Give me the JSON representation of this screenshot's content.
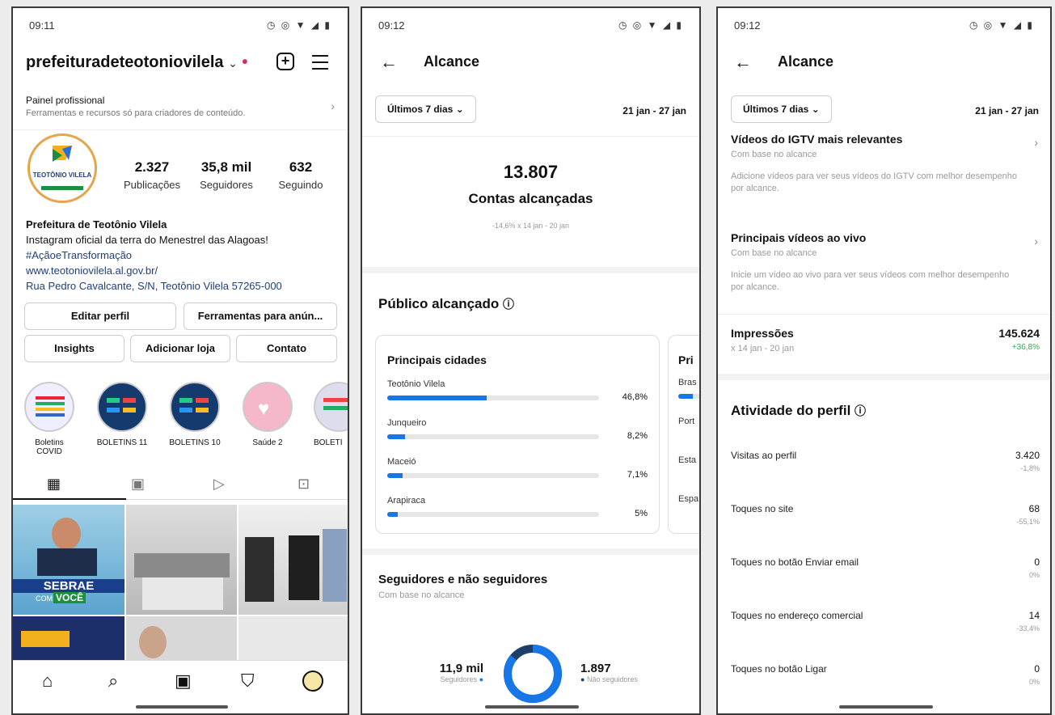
{
  "screen1": {
    "time": "09:11",
    "username": "prefeituradeteotoniovilela",
    "chevron": "⌄",
    "red_dot": "•",
    "pro_panel": {
      "title": "Painel profissional",
      "subtitle": "Ferramentas e recursos só para criadores de conteúdo."
    },
    "avatar_text": "TEOTÔNIO VILELA",
    "stats": [
      {
        "value": "2.327",
        "label": "Publicações"
      },
      {
        "value": "35,8 mil",
        "label": "Seguidores"
      },
      {
        "value": "632",
        "label": "Seguindo"
      }
    ],
    "bio": {
      "name": "Prefeitura de Teotônio Vilela",
      "line1": "Instagram oficial da terra do Menestrel das Alagoas!",
      "hashtag": "#AçãoeTransformação",
      "link": "www.teotoniovilela.al.gov.br/",
      "address": "Rua Pedro Cavalcante, S/N, Teotônio Vilela 57265-000"
    },
    "buttons": {
      "edit": "Editar perfil",
      "ads": "Ferramentas para anún...",
      "insights": "Insights",
      "shop": "Adicionar loja",
      "contact": "Contato"
    },
    "highlights": [
      "Boletins COVID",
      "BOLETINS 11",
      "BOLETINS 10",
      "Saúde 2",
      "BOLETI"
    ],
    "sebrae": {
      "l1": "SEBRAE",
      "l2": "COM",
      "l3": "VOCÊ"
    }
  },
  "screen2": {
    "time": "09:12",
    "title": "Alcance",
    "filter": "Últimos 7 dias",
    "date_range": "21 jan - 27 jan",
    "reach_value": "13.807",
    "reach_label": "Contas alcançadas",
    "reach_compare": "-14,6% x 14 jan - 20 jan",
    "audience_title": "Público alcançado",
    "cities_title": "Principais cidades",
    "cities": [
      {
        "name": "Teotônio Vilela",
        "pct": "46,8%",
        "value": 0.468
      },
      {
        "name": "Junqueiro",
        "pct": "8,2%",
        "value": 0.082
      },
      {
        "name": "Maceió",
        "pct": "7,1%",
        "value": 0.071
      },
      {
        "name": "Arapiraca",
        "pct": "5%",
        "value": 0.05
      }
    ],
    "next_card_title": "Pri",
    "next_card_rows": [
      "Bras",
      "Port",
      "Esta",
      "Espa"
    ],
    "followers_title": "Seguidores e não seguidores",
    "followers_sub": "Com base no alcance",
    "followers_value": "11,9 mil",
    "followers_label": "Seguidores",
    "nonfollowers_value": "1.897",
    "nonfollowers_label": "Não seguidores",
    "follower_share": 0.86
  },
  "screen3": {
    "time": "09:12",
    "title": "Alcance",
    "filter": "Últimos 7 dias",
    "date_range": "21 jan - 27 jan",
    "igtv_title": "Vídeos do IGTV mais relevantes",
    "igtv_sub": "Com base no alcance",
    "igtv_desc": "Adicione vídeos para ver seus vídeos do IGTV com melhor desempenho por alcance.",
    "live_title": "Principais vídeos ao vivo",
    "live_sub": "Com base no alcance",
    "live_desc": "Inicie um vídeo ao vivo para ver seus vídeos com melhor desempenho por alcance.",
    "impressions_label": "Impressões",
    "impressions_sub": "x 14 jan - 20 jan",
    "impressions_value": "145.624",
    "impressions_delta": "+36,8%",
    "activity_title": "Atividade do perfil",
    "metrics": [
      {
        "label": "Visitas ao perfil",
        "value": "3.420",
        "delta": "-1,8%"
      },
      {
        "label": "Toques no site",
        "value": "68",
        "delta": "-55,1%"
      },
      {
        "label": "Toques no botão Enviar email",
        "value": "0",
        "delta": "0%"
      },
      {
        "label": "Toques no endereço comercial",
        "value": "14",
        "delta": "-33,4%"
      },
      {
        "label": "Toques no botão Ligar",
        "value": "0",
        "delta": "0%"
      }
    ]
  },
  "colors": {
    "accent": "#1877e8",
    "positive": "#3aa655",
    "notif": "#e0245e"
  }
}
